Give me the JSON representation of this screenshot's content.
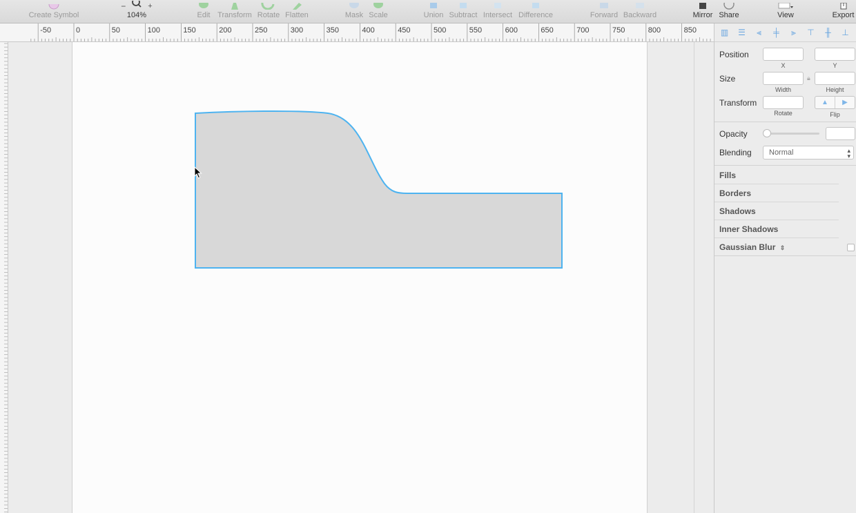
{
  "toolbar": {
    "create_symbol": "Create Symbol",
    "zoom_level": "104%",
    "zoom_minus": "−",
    "zoom_plus": "+",
    "edit": "Edit",
    "transform": "Transform",
    "rotate": "Rotate",
    "flatten": "Flatten",
    "mask": "Mask",
    "scale": "Scale",
    "union": "Union",
    "subtract": "Subtract",
    "intersect": "Intersect",
    "difference": "Difference",
    "forward": "Forward",
    "backward": "Backward",
    "mirror": "Mirror",
    "share": "Share",
    "view": "View",
    "export": "Export"
  },
  "ruler": {
    "labels": [
      "-50",
      "0",
      "50",
      "100",
      "150",
      "200",
      "250",
      "300",
      "350",
      "400",
      "450",
      "500",
      "550",
      "600",
      "650",
      "700",
      "750",
      "800",
      "850"
    ]
  },
  "inspector": {
    "position_label": "Position",
    "x_label": "X",
    "y_label": "Y",
    "size_label": "Size",
    "width_label": "Width",
    "height_label": "Height",
    "transform_label": "Transform",
    "rotate_label": "Rotate",
    "flip_label": "Flip",
    "opacity_label": "Opacity",
    "blending_label": "Blending",
    "blending_value": "Normal",
    "sections": {
      "fills": "Fills",
      "borders": "Borders",
      "shadows": "Shadows",
      "inner_shadows": "Inner Shadows",
      "gaussian_blur": "Gaussian Blur"
    }
  },
  "colors": {
    "accent": "#4db3f0",
    "shape_fill": "#d8d8d8",
    "artboard": "#fcfcfc"
  }
}
